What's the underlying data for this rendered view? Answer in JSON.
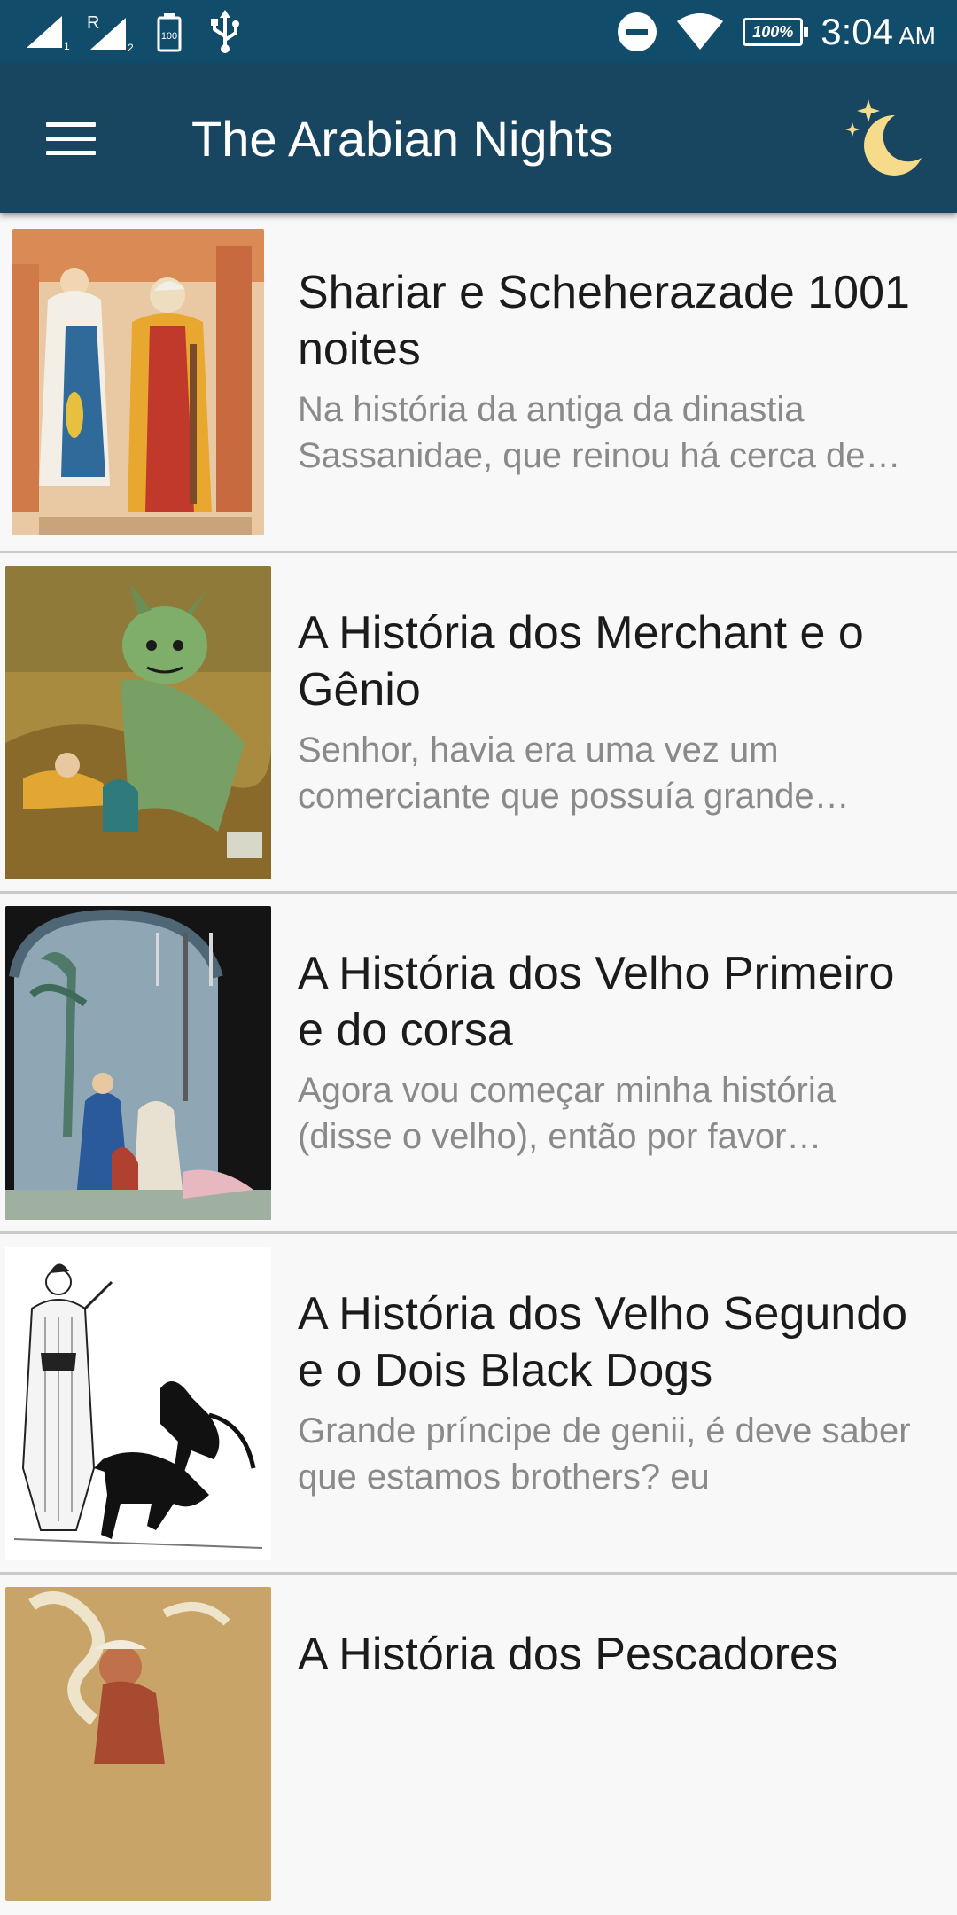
{
  "status_bar": {
    "time": "3:04",
    "ampm": "AM",
    "battery_percent": "100%",
    "icons": [
      "signal-sim1-icon",
      "signal-sim2-roaming-icon",
      "battery-saver-icon",
      "usb-icon",
      "do-not-disturb-icon",
      "wifi-icon",
      "battery-icon"
    ]
  },
  "app_bar": {
    "title": "The Arabian Nights",
    "menu_icon": "hamburger-menu-icon",
    "night_mode_icon": "moon-stars-icon"
  },
  "colors": {
    "status_bar": "#114c6b",
    "app_bar": "#184660",
    "moon": "#f6dc8a",
    "title_text": "#1b1b1b",
    "desc_text": "#8a8a8a",
    "divider": "#c9c9c9"
  },
  "stories": [
    {
      "title": "Shariar e Scheherazade 1001 noites",
      "description": "Na história da antiga da dinastia Sassanidae, que reinou há cerca de mil anos",
      "image": "scheherazade-and-sultan-illustration"
    },
    {
      "title": "A História dos Merchant e o Gênio",
      "description": "Senhor, havia era uma vez um comerciante que possuía grande riqueza",
      "image": "genie-and-merchant-illustration"
    },
    {
      "title": "A História dos Velho Primeiro e do corsa",
      "description": "Agora vou começar minha história (disse o velho), então por favor conceda",
      "image": "old-man-and-hind-illustration"
    },
    {
      "title": "A História dos Velho Segundo e o Dois Black Dogs",
      "description": "Grande príncipe de   genii, é   deve saber que estamos     brothers? eu",
      "image": "old-man-and-black-dogs-illustration"
    },
    {
      "title": "A História dos Pescadores",
      "description": "",
      "image": "fisherman-and-smoke-illustration"
    }
  ]
}
